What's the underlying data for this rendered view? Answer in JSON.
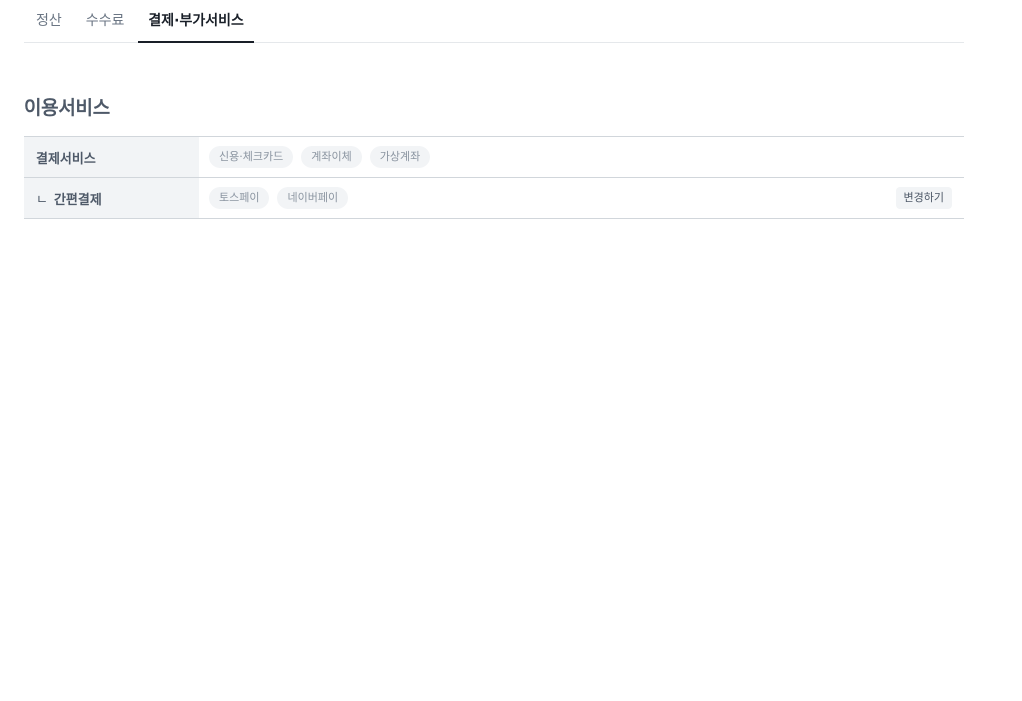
{
  "tabs": [
    {
      "label": "정산",
      "active": false
    },
    {
      "label": "수수료",
      "active": false
    },
    {
      "label": "결제·부가서비스",
      "active": true
    }
  ],
  "section": {
    "title": "이용서비스"
  },
  "rows": [
    {
      "label": "결제서비스",
      "prefix": "",
      "chips": [
        "신용·체크카드",
        "계좌이체",
        "가상계좌"
      ]
    },
    {
      "label": "간편결제",
      "prefix": "ㄴ",
      "chips": [
        "토스페이",
        "네이버페이"
      ],
      "action_label": "변경하기"
    }
  ],
  "colors": {
    "active_tab": "#191f28",
    "inactive_tab": "#6b7684",
    "label_bg": "#f2f4f6",
    "chip_bg": "#f2f4f6",
    "chip_text": "#8b95a1",
    "border": "#d1d6db"
  }
}
